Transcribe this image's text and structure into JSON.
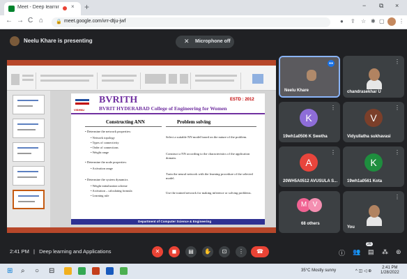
{
  "browser": {
    "tab_title": "Meet - Deep learning and",
    "tab_close": "×",
    "new_tab": "+",
    "url": "meet.google.com/vrr-dtju-jwf",
    "win_minimize": "−",
    "win_restore": "⧉",
    "win_close": "×",
    "back": "←",
    "forward": "→",
    "reload": "C",
    "home": "⌂"
  },
  "meet": {
    "presenting_text": "Neelu Khare is presenting",
    "mic_status": "Microphone off",
    "meeting_time": "2:41 PM",
    "meeting_separator": "|",
    "meeting_title": "Deep learning and Applications",
    "chat_badge": "26",
    "colors": {
      "end_call": "#ea4335",
      "tile_bg": "#3c4043",
      "speaking_border": "#8ab4f8"
    }
  },
  "participants": [
    {
      "name": "Neelu Khare",
      "kind": "camera"
    },
    {
      "name": "chandrasekhar U",
      "kind": "photo"
    },
    {
      "name": "19wh1a0506 K Swetha",
      "initial": "K",
      "color": "#8e6dd8"
    },
    {
      "name": "Vidyullatha sukhavasi",
      "initial": "V",
      "color": "#7b3f2a"
    },
    {
      "name": "20WH5A0512 AVUSULA S...",
      "initial": "A",
      "color": "#e8453c"
    },
    {
      "name": "19wh1a0561 Kota",
      "initial": "K",
      "color": "#1e8e3e"
    },
    {
      "name": "68 others",
      "initials": [
        "M",
        "V"
      ],
      "color": "#f06292"
    },
    {
      "name": "You",
      "kind": "photo"
    }
  ],
  "slide": {
    "brand": "BVRITH",
    "college": "BVRIT HYDERABAD College of Engineering for Women",
    "estd": "ESTD : 2012",
    "logo_text": "VISHNU",
    "left_heading": "Constructing ANN",
    "right_heading": "Problem solving",
    "left_items": [
      "Determine the network properties:",
      "Network topology",
      "Types of connectivity",
      "Order of connections",
      "Weight range",
      "Determine the node properties:",
      "Activation range",
      "Determine the system dynamics",
      "Weight initialization scheme",
      "Activation – calculating formula",
      "Learning rule"
    ],
    "right_items": [
      "Select a suitable NN model based on the nature of the problem.",
      "Construct a NN according to the characteristics of the application domain.",
      "Train the neural network with the learning procedure of the selected model.",
      "Use the trained network for making inference or solving problems."
    ],
    "footer": "Department of Computer Science & Engineering"
  },
  "taskbar": {
    "weather": "35°C  Mostly sunny",
    "time": "2:41 PM",
    "date": "1/28/2022"
  }
}
